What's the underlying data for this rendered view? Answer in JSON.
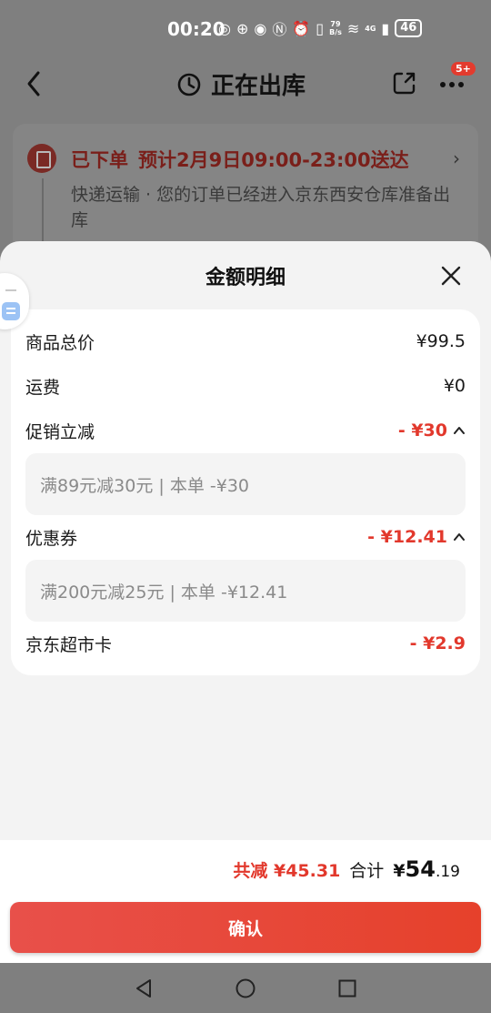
{
  "status_bar": {
    "time": "00:20",
    "net_speed_top": "79",
    "net_speed_bottom": "B/s",
    "signal_label": "4G",
    "battery": "46"
  },
  "nav": {
    "title": "正在出库",
    "badge": "5+"
  },
  "order": {
    "status": "已下单",
    "eta": "预计2月9日09:00-23:00送达",
    "description": "快递运输 · 您的订单已经进入京东西安仓库准备出库"
  },
  "sheet": {
    "title": "金额明细",
    "rows": [
      {
        "label": "商品总价",
        "value": "¥99.5"
      },
      {
        "label": "运费",
        "value": "¥0"
      },
      {
        "label": "促销立减",
        "value": "- ¥30",
        "detail": "满89元减30元 | 本单 -¥30"
      },
      {
        "label": "优惠券",
        "value": "- ¥12.41",
        "detail": "满200元减25元 | 本单 -¥12.41"
      },
      {
        "label": "京东超市卡",
        "value": "- ¥2.9"
      }
    ]
  },
  "summary": {
    "total_reduce": "共减 ¥45.31",
    "total_label": "合计",
    "currency": "¥",
    "total_int": "54",
    "total_dec": ".19",
    "confirm_label": "确认"
  },
  "colors": {
    "accent_red": "#e2382c",
    "button_gradient_start": "#e8504a",
    "button_gradient_end": "#e6412b"
  }
}
